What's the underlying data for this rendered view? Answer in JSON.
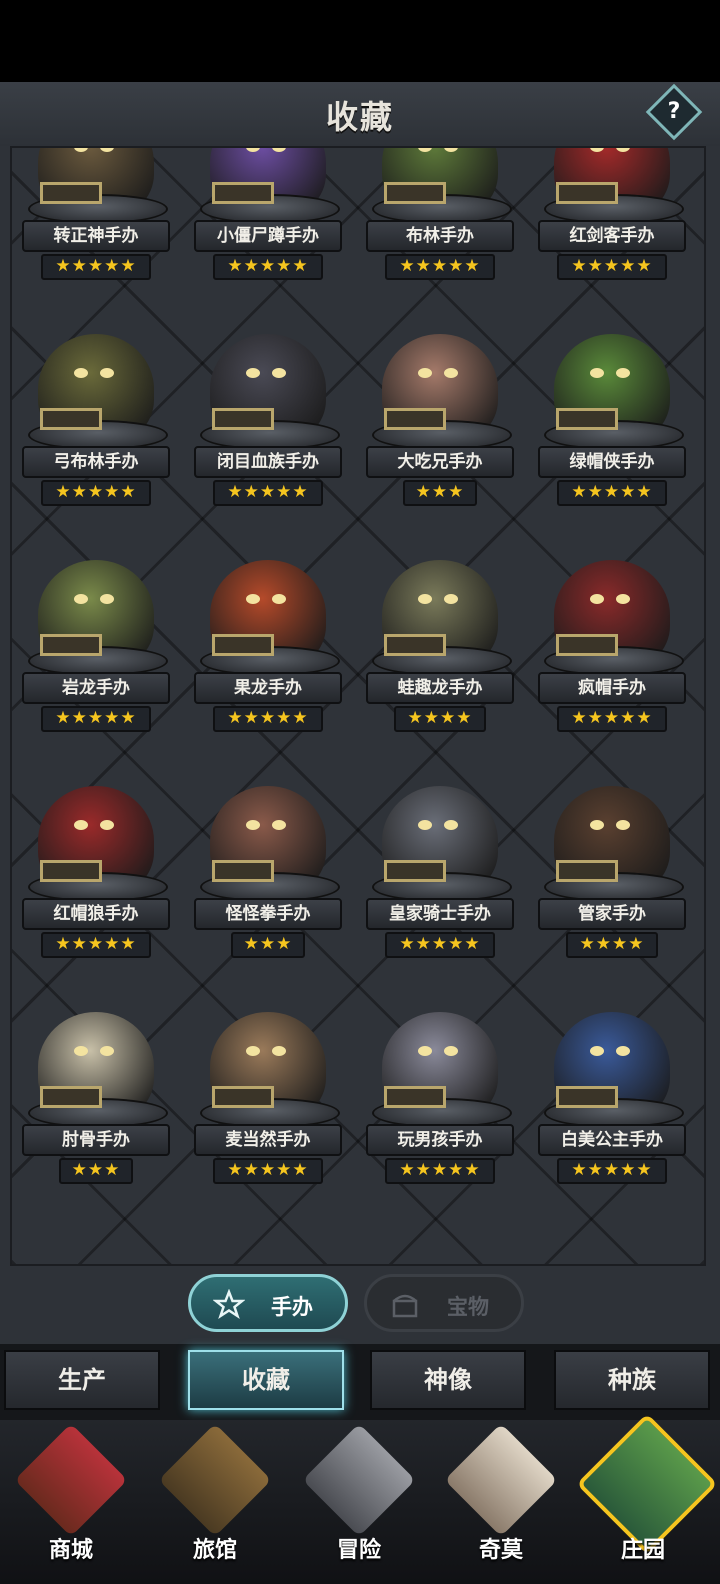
{
  "header": {
    "title": "收藏",
    "help_label": "?"
  },
  "collection": {
    "figures": [
      {
        "name": "转正神手办",
        "stars": 5,
        "color": "#6b5a3e"
      },
      {
        "name": "小僵尸蹲手办",
        "stars": 5,
        "color": "#6d4ea3"
      },
      {
        "name": "布林手办",
        "stars": 5,
        "color": "#5e7a3a"
      },
      {
        "name": "红剑客手办",
        "stars": 5,
        "color": "#a52a2a"
      },
      {
        "name": "弓布林手办",
        "stars": 5,
        "color": "#6a6a3a"
      },
      {
        "name": "闭目血族手办",
        "stars": 5,
        "color": "#4a4a55"
      },
      {
        "name": "大吃兄手办",
        "stars": 3,
        "color": "#a57a6a"
      },
      {
        "name": "绿帽侠手办",
        "stars": 5,
        "color": "#5a8a3a"
      },
      {
        "name": "岩龙手办",
        "stars": 5,
        "color": "#7a8a4a"
      },
      {
        "name": "果龙手办",
        "stars": 5,
        "color": "#b54a2a"
      },
      {
        "name": "蛙趣龙手办",
        "stars": 4,
        "color": "#7a7a5a"
      },
      {
        "name": "疯帽手办",
        "stars": 5,
        "color": "#8a2a2a"
      },
      {
        "name": "红帽狼手办",
        "stars": 5,
        "color": "#9a2a2a"
      },
      {
        "name": "怪怪拳手办",
        "stars": 3,
        "color": "#8a5a4a"
      },
      {
        "name": "皇家骑士手办",
        "stars": 5,
        "color": "#6a6e78"
      },
      {
        "name": "管家手办",
        "stars": 4,
        "color": "#5a4030"
      },
      {
        "name": "肘骨手办",
        "stars": 3,
        "color": "#c8c0a8"
      },
      {
        "name": "麦当然手办",
        "stars": 5,
        "color": "#9a7a5a"
      },
      {
        "name": "玩男孩手办",
        "stars": 5,
        "color": "#8a8a9a"
      },
      {
        "name": "白美公主手办",
        "stars": 5,
        "color": "#3a5a9a"
      }
    ]
  },
  "subtabs": {
    "figures_label": "手办",
    "treasures_label": "宝物"
  },
  "tabs": {
    "production": "生产",
    "collection": "收藏",
    "statue": "神像",
    "race": "种族"
  },
  "nav": {
    "shop": "商城",
    "inn": "旅馆",
    "adventure": "冒险",
    "qimo": "奇莫",
    "manor": "庄园"
  }
}
